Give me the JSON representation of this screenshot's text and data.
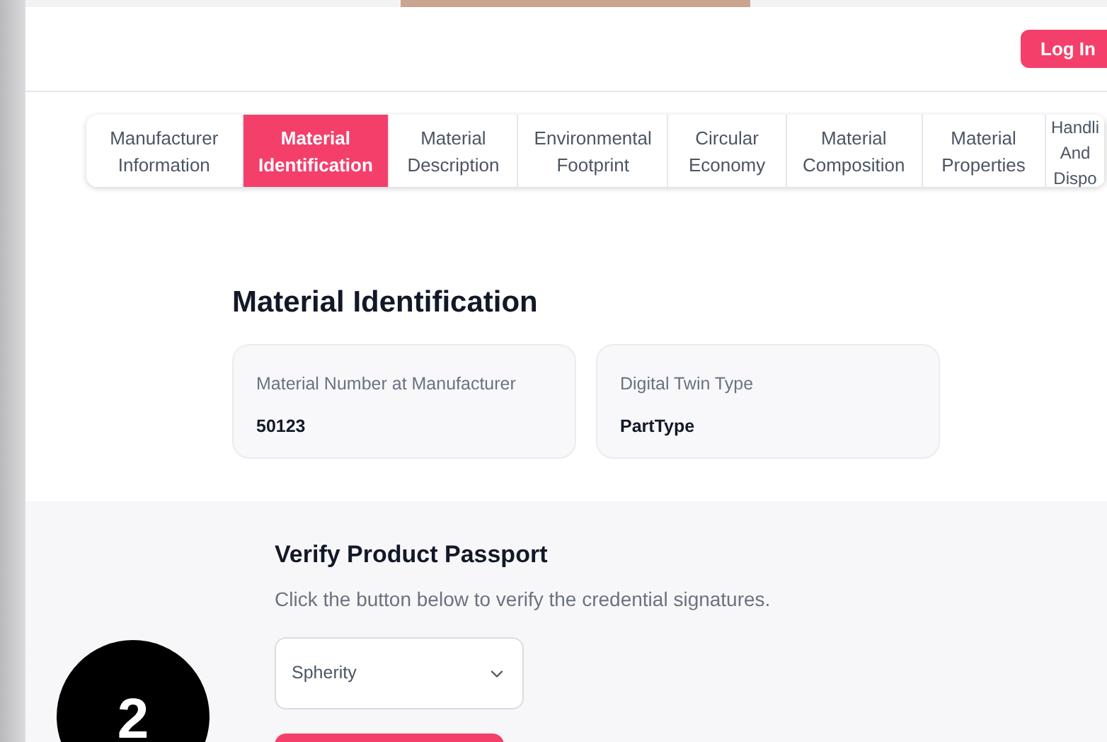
{
  "header": {
    "login_button": "Log In"
  },
  "tabs": [
    {
      "label": "Manufacturer Information",
      "selected": false
    },
    {
      "label": "Material Identification",
      "selected": true
    },
    {
      "label": "Material Description",
      "selected": false
    },
    {
      "label": "Environmental Footprint",
      "selected": false
    },
    {
      "label": "Circular Economy",
      "selected": false
    },
    {
      "label": "Material Composition",
      "selected": false
    },
    {
      "label": "Material Properties",
      "selected": false
    },
    {
      "label": "Handli And Dispo",
      "selected": false
    }
  ],
  "section": {
    "title": "Material Identification",
    "fields": [
      {
        "label": "Material Number at Manufacturer",
        "value": "50123"
      },
      {
        "label": "Digital Twin Type",
        "value": "PartType"
      }
    ]
  },
  "verify": {
    "title": "Verify Product Passport",
    "description": "Click the button below to verify the credential signatures.",
    "select": {
      "value": "Spherity"
    }
  },
  "step_badge": "2"
}
